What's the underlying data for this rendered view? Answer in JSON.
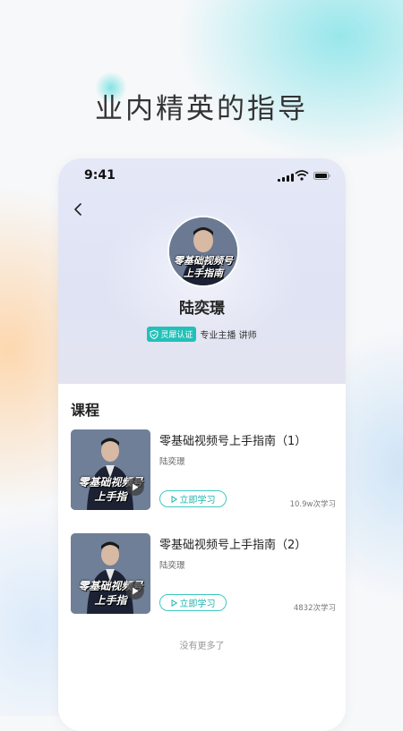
{
  "hero": {
    "title": "业内精英的指导"
  },
  "status_bar": {
    "time": "9:41"
  },
  "profile": {
    "avatar_text": [
      "零基础视频号",
      "上手指南"
    ],
    "name": "陆奕璟",
    "cert_label": "灵犀认证",
    "roles": "专业主播 讲师"
  },
  "courses": {
    "section_title": "课程",
    "items": [
      {
        "title": "零基础视频号上手指南（1）",
        "teacher": "陆奕璟",
        "button": "立即学习",
        "count": "10.9w次学习",
        "thumb_text": [
          "零基础视频号",
          "上手指"
        ]
      },
      {
        "title": "零基础视频号上手指南（2）",
        "teacher": "陆奕璟",
        "button": "立即学习",
        "count": "4832次学习",
        "thumb_text": [
          "零基础视频号",
          "上手指"
        ]
      }
    ],
    "footer": "没有更多了"
  },
  "colors": {
    "accent": "#23c0b8",
    "text": "#222222"
  }
}
